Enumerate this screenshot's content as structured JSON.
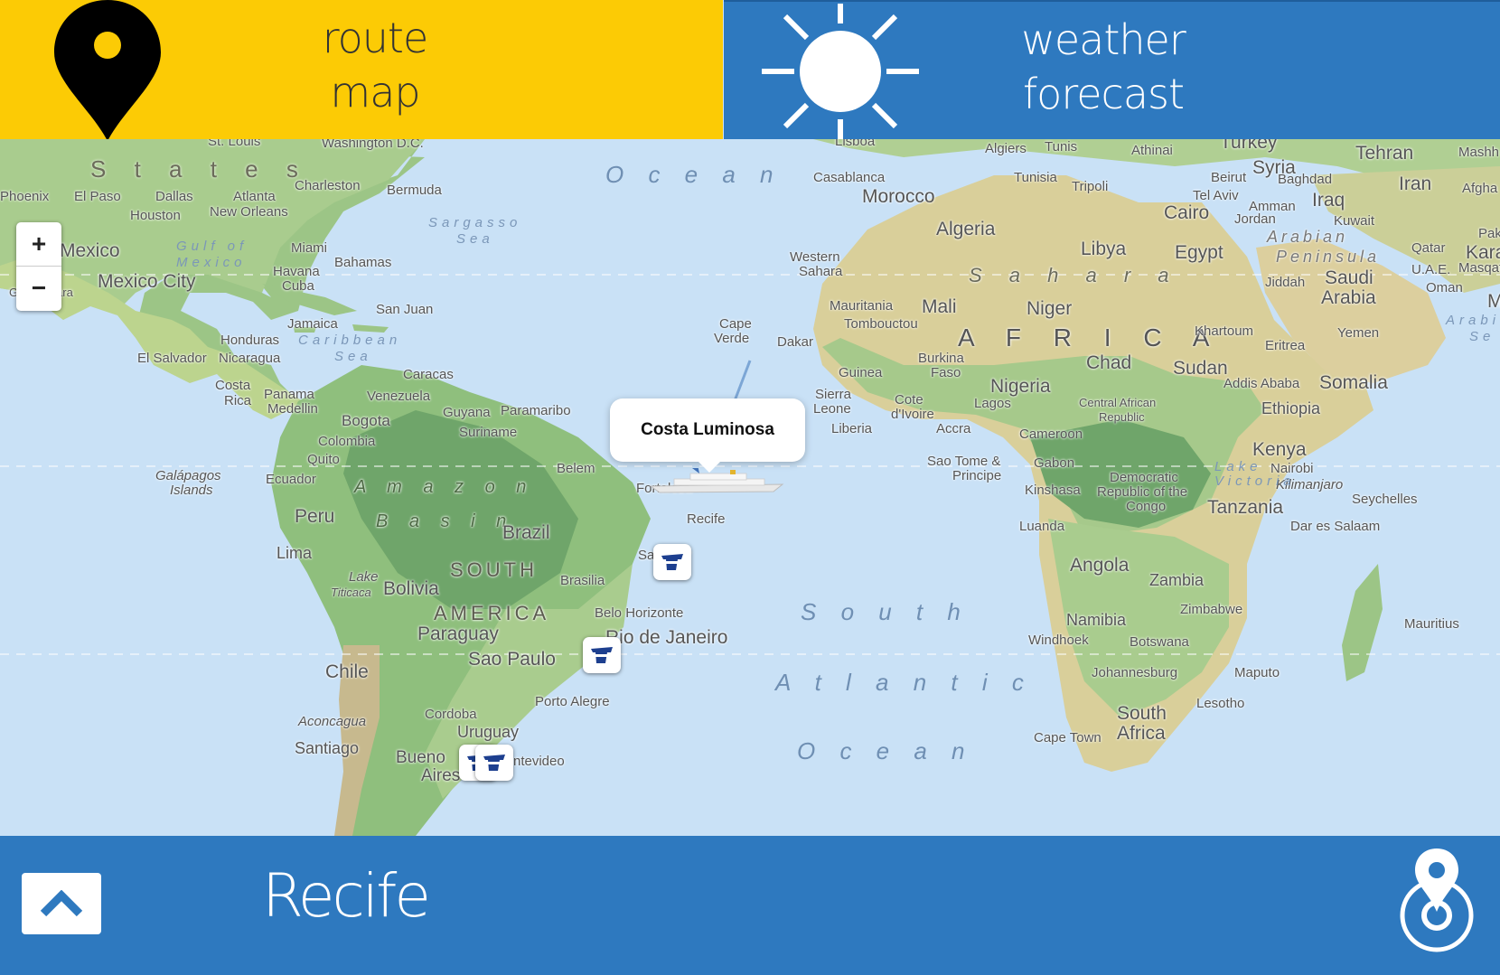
{
  "tabs": {
    "route": {
      "line1": "route",
      "line2": "map"
    },
    "weather": {
      "line1": "weather",
      "line2": "forecast"
    }
  },
  "zoom": {
    "in": "+",
    "out": "−"
  },
  "popup": {
    "ship_name": "Costa Luminosa"
  },
  "bottom": {
    "port_name": "Recife"
  },
  "map_labels": {
    "states": "S t a t e s",
    "phoenix": "Phoenix",
    "el_paso": "El Paso",
    "dallas": "Dallas",
    "atlanta": "Atlanta",
    "charleston": "Charleston",
    "st_louis": "St. Louis",
    "washington": "Washington D.C.",
    "houston": "Houston",
    "new_orleans": "New Orleans",
    "bermuda": "Bermuda",
    "gulf": "Gulf of",
    "mexico_water": "Mexico",
    "mexico": "Mexico",
    "mexico_city": "Mexico City",
    "guadalajara": "Guadalajara",
    "miami": "Miami",
    "havana": "Havana",
    "cuba": "Cuba",
    "bahamas": "Bahamas",
    "sargasso": "Sargasso",
    "sargasso_sea": "Sea",
    "san_juan": "San Juan",
    "jamaica": "Jamaica",
    "honduras": "Honduras",
    "caribbean": "Caribbean",
    "caribbean_sea": "Sea",
    "el_salvador": "El Salvador",
    "nicaragua": "Nicaragua",
    "costa_rica_1": "Costa",
    "costa_rica_2": "Rica",
    "panama": "Panama",
    "medellin": "Medellin",
    "caracas": "Caracas",
    "venezuela": "Venezuela",
    "bogota": "Bogota",
    "colombia": "Colombia",
    "guyana": "Guyana",
    "paramaribo": "Paramaribo",
    "suriname": "Suriname",
    "quito": "Quito",
    "ecuador": "Ecuador",
    "galapagos_1": "Galápagos",
    "galapagos_2": "Islands",
    "amazon": "A m a z o n",
    "basin": "B a s i n",
    "belem": "Belem",
    "fortaleza": "Fortaleza",
    "recife": "Recife",
    "salvador": "Salvador",
    "peru": "Peru",
    "lima": "Lima",
    "brazil": "Brazil",
    "south": "SOUTH",
    "america": "AMERICA",
    "brasilia": "Brasilia",
    "lake": "Lake",
    "titicaca": "Titicaca",
    "bolivia": "Bolivia",
    "paraguay": "Paraguay",
    "belo_horizonte": "Belo Horizonte",
    "rio": "Rio de Janeiro",
    "sao_paulo": "Sao Paulo",
    "chile": "Chile",
    "porto_alegre": "Porto Alegre",
    "aconcagua": "Aconcagua",
    "cordoba": "Cordoba",
    "uruguay": "Uruguay",
    "santiago": "Santiago",
    "buenos_aires_1": "Bueno",
    "buenos_aires_2": "Aires",
    "montevideo": "ntevideo",
    "ocean_top": "O c e a n",
    "south_atlantic_1": "S o u t h",
    "south_atlantic_2": "A t l a n t i c",
    "south_atlantic_3": "O c e a n",
    "cape_verde_1": "Cape",
    "cape_verde_2": "Verde",
    "dakar": "Dakar",
    "lisboa": "Lisboa",
    "algiers": "Algiers",
    "tunis": "Tunis",
    "athinai": "Athinai",
    "turkey": "Turkey",
    "tehran": "Tehran",
    "mashhad": "Mashh",
    "casablanca": "Casablanca",
    "morocco": "Morocco",
    "tunisia": "Tunisia",
    "tripoli": "Tripoli",
    "beirut": "Beirut",
    "syria": "Syria",
    "baghdad": "Baghdad",
    "iran": "Iran",
    "afgha": "Afgha",
    "tel_aviv": "Tel Aviv",
    "amman": "Amman",
    "iraq": "Iraq",
    "algeria": "Algeria",
    "libya": "Libya",
    "egypt": "Egypt",
    "cairo": "Cairo",
    "jordan": "Jordan",
    "kuwait": "Kuwait",
    "western_sahara_1": "Western",
    "western_sahara_2": "Sahara",
    "sahara": "S a h a r a",
    "arabian": "Arabian",
    "peninsula": "Peninsula",
    "qatar": "Qatar",
    "uae": "U.A.E.",
    "masqat": "Masqat",
    "karachi": "Kara",
    "saudi_1": "Saudi",
    "saudi_2": "Arabia",
    "jiddah": "Jiddah",
    "oman": "Oman",
    "pak": "Pak",
    "mauritania": "Mauritania",
    "mali": "Mali",
    "niger": "Niger",
    "tombouctou": "Tombouctou",
    "africa": "A F R I C A",
    "khartoum": "Khartoum",
    "yemen": "Yemen",
    "arabian_sea_1": "Arabi",
    "arabian_sea_2": "Se",
    "burkina_1": "Burkina",
    "burkina_2": "Faso",
    "chad": "Chad",
    "eritrea": "Eritrea",
    "sudan": "Sudan",
    "guinea": "Guinea",
    "sierra_1": "Sierra",
    "sierra_2": "Leone",
    "cote_1": "Cote",
    "cote_2": "d'Ivoire",
    "nigeria": "Nigeria",
    "lagos": "Lagos",
    "addis": "Addis Ababa",
    "somalia": "Somalia",
    "liberia": "Liberia",
    "accra": "Accra",
    "car_1": "Central African",
    "car_2": "Republic",
    "ethiopia": "Ethiopia",
    "cameroon": "Cameroon",
    "sao_tome_1": "Sao Tome &",
    "sao_tome_2": "Principe",
    "gabon": "Gabon",
    "drc_1": "Democratic",
    "drc_2": "Republic of the",
    "drc_3": "Congo",
    "kenya": "Kenya",
    "nairobi": "Nairobi",
    "kilimanjaro": "Kilimanjaro",
    "lake_victoria_1": "Lake",
    "lake_victoria_2": "Victoria",
    "kinshasa": "Kinshasa",
    "tanzania": "Tanzania",
    "seychelles": "Seychelles",
    "luanda": "Luanda",
    "dar": "Dar es Salaam",
    "angola": "Angola",
    "zambia": "Zambia",
    "namibia": "Namibia",
    "zimbabwe": "Zimbabwe",
    "mauritius": "Mauritius",
    "windhoek": "Windhoek",
    "botswana": "Botswana",
    "johannesburg": "Johannesburg",
    "maputo": "Maputo",
    "lesotho": "Lesotho",
    "cape_town": "Cape Town",
    "south_africa_1": "South",
    "south_africa_2": "Africa",
    "m_edge": "M"
  }
}
